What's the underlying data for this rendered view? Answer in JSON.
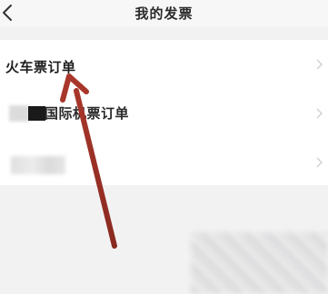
{
  "header": {
    "title": "我的发票",
    "back_icon": "chevron-left-icon"
  },
  "invoice_list": {
    "items": [
      {
        "label": "火车票订单",
        "icon": "chevron-right-icon"
      },
      {
        "label": "国际机票订单",
        "icon": "chevron-right-icon"
      },
      {
        "label": "",
        "icon": "chevron-right-icon"
      }
    ]
  },
  "colors": {
    "background": "#f2f2f3",
    "list_background": "#ffffff",
    "arrow_annotation": "#9b2d22"
  }
}
